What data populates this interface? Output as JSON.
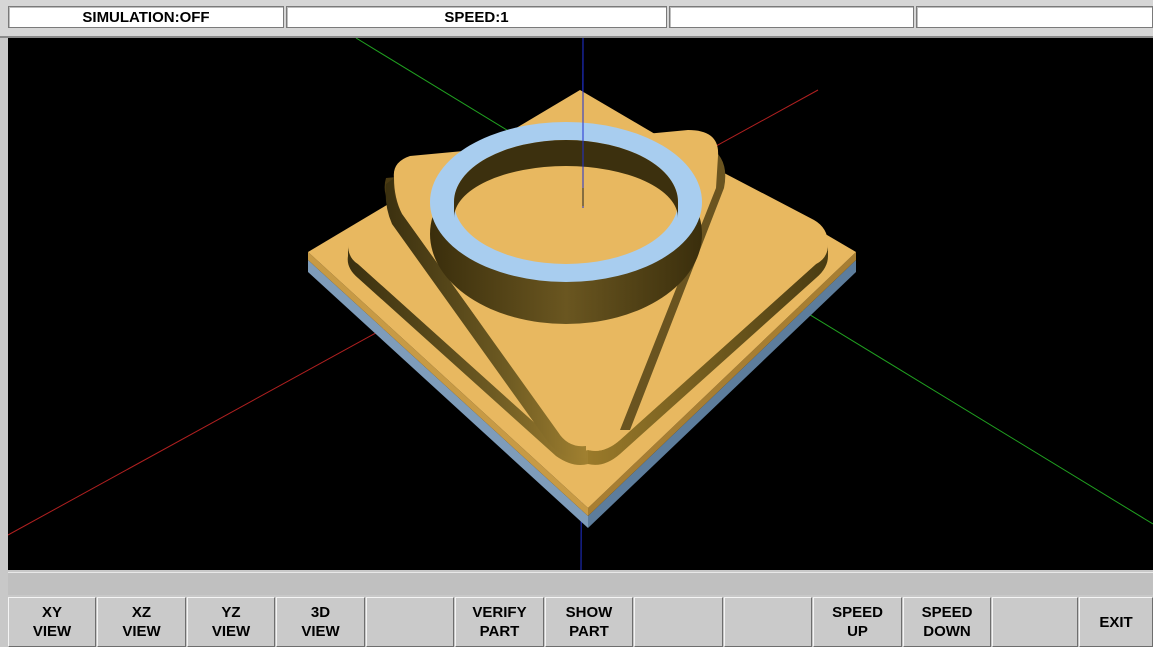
{
  "status_bar": {
    "simulation": "SIMULATION:OFF",
    "speed": "SPEED:1",
    "field3": "",
    "field4": ""
  },
  "message_bar": {
    "text": ""
  },
  "softkeys": [
    {
      "line1": "XY",
      "line2": "VIEW"
    },
    {
      "line1": "XZ",
      "line2": "VIEW"
    },
    {
      "line1": "YZ",
      "line2": "VIEW"
    },
    {
      "line1": "3D",
      "line2": "VIEW"
    },
    {
      "line1": "",
      "line2": ""
    },
    {
      "line1": "VERIFY",
      "line2": "PART"
    },
    {
      "line1": "SHOW",
      "line2": "PART"
    },
    {
      "line1": "",
      "line2": ""
    },
    {
      "line1": "",
      "line2": ""
    },
    {
      "line1": "SPEED",
      "line2": "UP"
    },
    {
      "line1": "SPEED",
      "line2": "DOWN"
    },
    {
      "line1": "",
      "line2": ""
    },
    {
      "line1": "EXIT",
      "line2": ""
    }
  ],
  "colors": {
    "part_top": "#e8b860",
    "part_side": "#5a4a1c",
    "ring": "#a8cdef",
    "stock_side": "#7d9bb8",
    "x_axis": "#cc2222",
    "y_axis": "#22aa22",
    "z_axis": "#2222cc"
  }
}
